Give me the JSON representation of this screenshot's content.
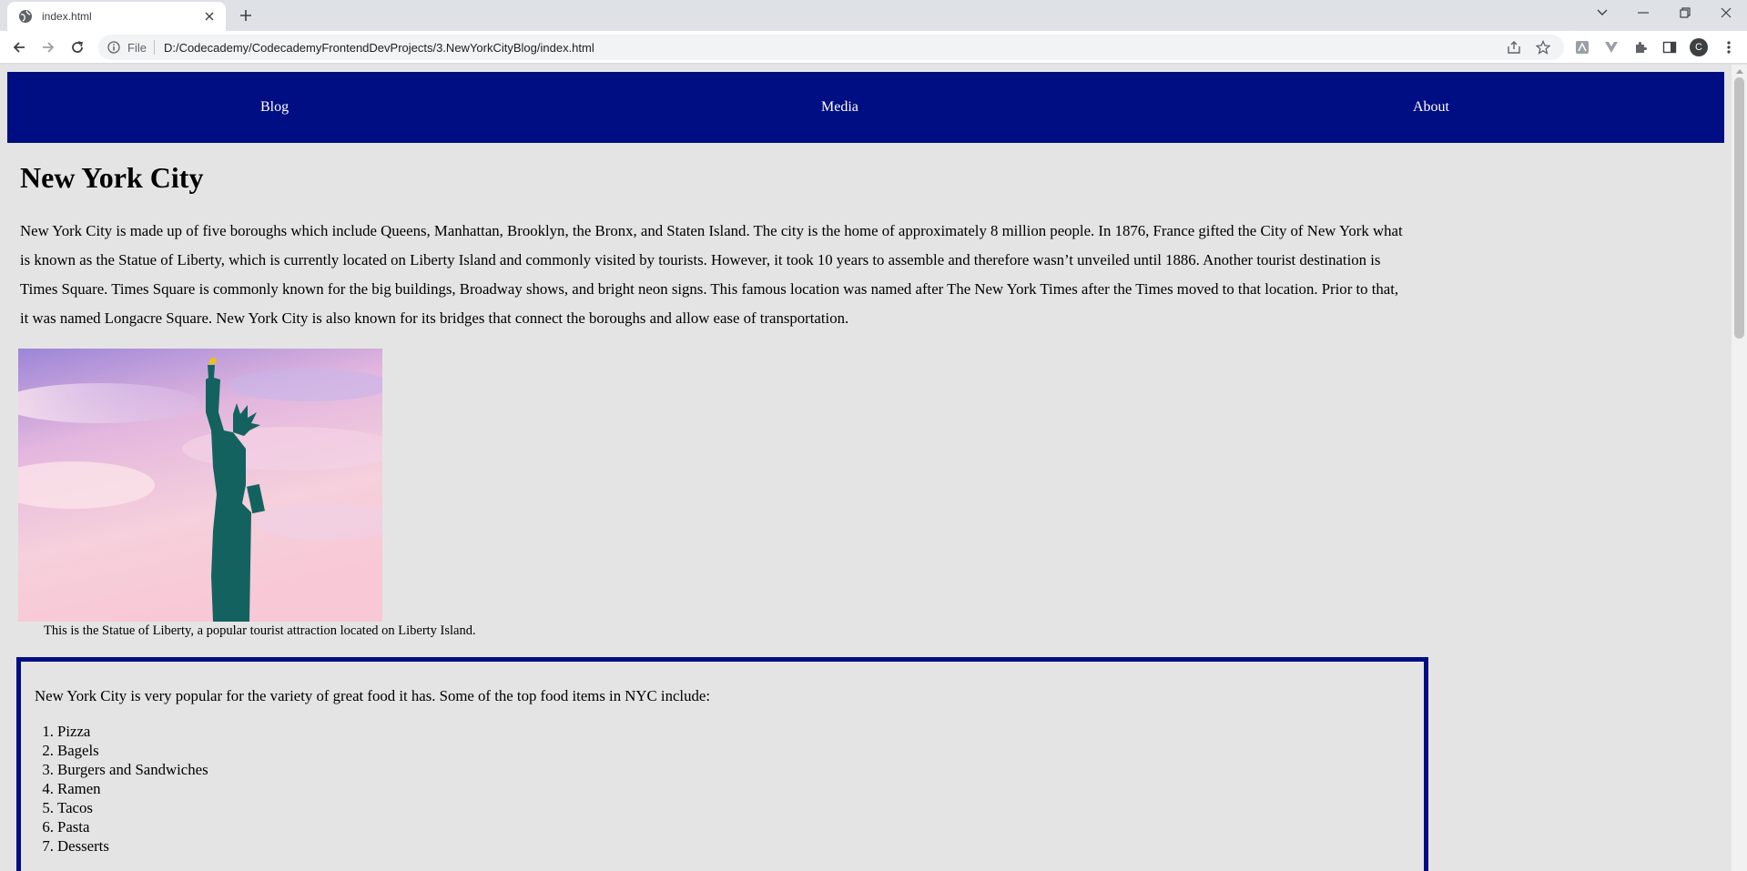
{
  "browser": {
    "tab_title": "index.html",
    "omnibox_scheme": "File",
    "url": "D:/Codecademy/CodecademyFrontendDevProjects/3.NewYorkCityBlog/index.html",
    "profile_initial": "C"
  },
  "nav": {
    "items": [
      "Blog",
      "Media",
      "About"
    ]
  },
  "page": {
    "title": "New York City",
    "intro": "New York City is made up of five boroughs which include Queens, Manhattan, Brooklyn, the Bronx, and Staten Island. The city is the home of approximately 8 million people. In 1876, France gifted the City of New York what is known as the Statue of Liberty, which is currently located on Liberty Island and commonly visited by tourists. However, it took 10 years to assemble and therefore wasn’t unveiled until 1886. Another tourist destination is Times Square. Times Square is commonly known for the big buildings, Broadway shows, and bright neon signs. This famous location was named after The New York Times after the Times moved to that location. Prior to that, it was named Longacre Square. New York City is also known for its bridges that connect the boroughs and allow ease of transportation.",
    "caption": "This is the Statue of Liberty, a popular tourist attraction located on Liberty Island.",
    "food_intro": "New York City is very popular for the variety of great food it has. Some of the top food items in NYC include:",
    "food_items": [
      "Pizza",
      "Bagels",
      "Burgers and Sandwiches",
      "Ramen",
      "Tacos",
      "Pasta",
      "Desserts"
    ]
  },
  "colors": {
    "nav_bg": "#000e83",
    "page_bg": "#e5e4e5",
    "box_border": "#000e83"
  }
}
